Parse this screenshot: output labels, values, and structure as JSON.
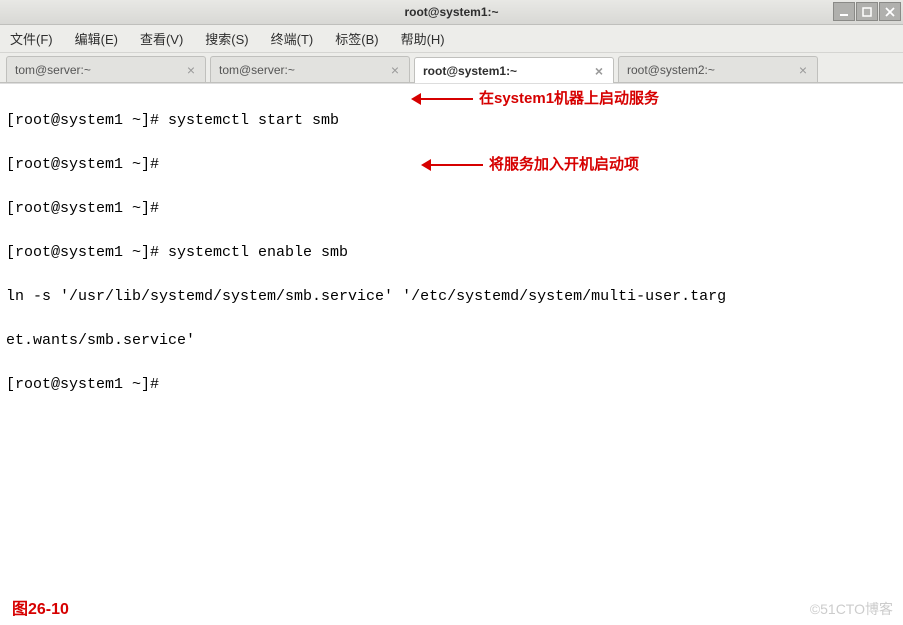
{
  "window": {
    "title": "root@system1:~"
  },
  "menu": {
    "file": "文件(F)",
    "edit": "编辑(E)",
    "view": "查看(V)",
    "search": "搜索(S)",
    "terminal": "终端(T)",
    "tabs": "标签(B)",
    "help": "帮助(H)"
  },
  "tabs": [
    {
      "label": "tom@server:~",
      "active": false
    },
    {
      "label": "tom@server:~",
      "active": false
    },
    {
      "label": "root@system1:~",
      "active": true
    },
    {
      "label": "root@system2:~",
      "active": false
    }
  ],
  "close_glyph": "×",
  "terminal_lines": [
    "[root@system1 ~]# systemctl start smb",
    "[root@system1 ~]#",
    "[root@system1 ~]#",
    "[root@system1 ~]# systemctl enable smb",
    "ln -s '/usr/lib/systemd/system/smb.service' '/etc/systemd/system/multi-user.targ",
    "et.wants/smb.service'",
    "[root@system1 ~]# "
  ],
  "annotations": {
    "a1": "在system1机器上启动服务",
    "a2": "将服务加入开机启动项"
  },
  "figure_label": "图26-10",
  "watermark": "©51CTO博客"
}
